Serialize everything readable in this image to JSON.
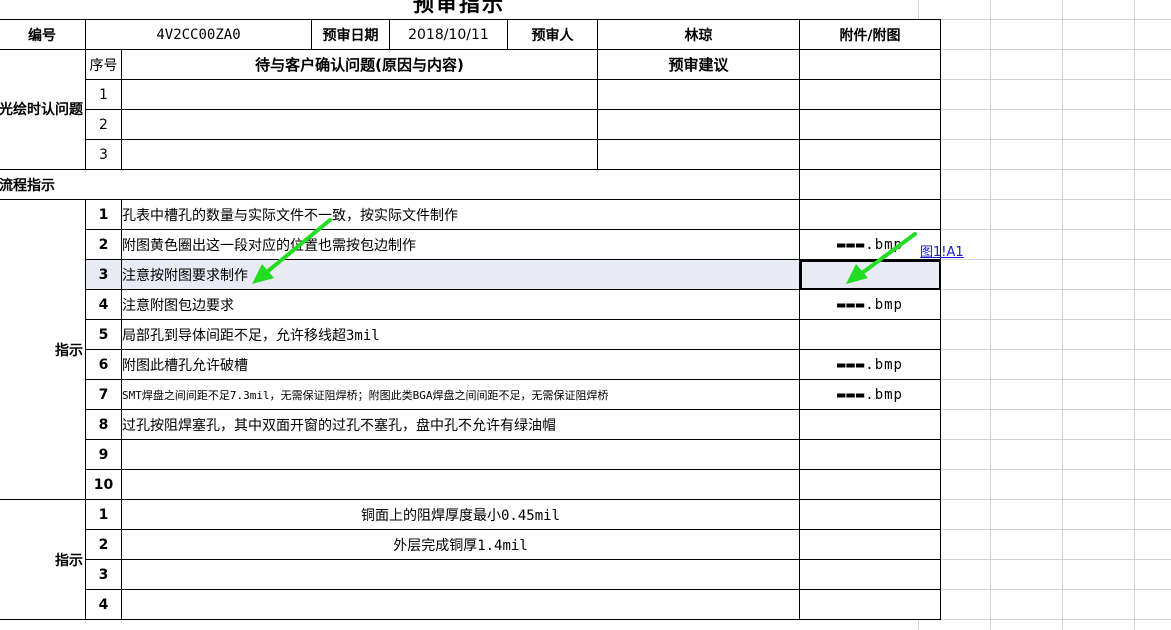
{
  "sheet": {
    "title": "预审指示",
    "header": {
      "label_no": "编号",
      "code": "4V2CC00ZA0",
      "label_date": "预审日期",
      "date": "2018/10/11",
      "label_reviewer": "预审人",
      "reviewer": "林琼",
      "label_attach": "附件/附图"
    },
    "confirm": {
      "side_label": "光绘时认问题",
      "col_seq": "序号",
      "col_issue": "待与客户确认问题(原因与内容)",
      "col_suggest": "预审建议",
      "rows": [
        "1",
        "2",
        "3"
      ]
    },
    "flow_label": "流程指示",
    "section_a": {
      "side_label": "指示",
      "rows": [
        {
          "no": "1",
          "text": "孔表中槽孔的数量与实际文件不一致，按实际文件制作",
          "attach": ""
        },
        {
          "no": "2",
          "text": "附图黄色圈出这一段对应的位置也需按包边制作",
          "attach": "▬▬▬.bmp"
        },
        {
          "no": "3",
          "text": "注意按附图要求制作",
          "attach": ""
        },
        {
          "no": "4",
          "text": "注意附图包边要求",
          "attach": "▬▬▬.bmp"
        },
        {
          "no": "5",
          "text": "局部孔到导体间距不足，允许移线超3mil",
          "attach": ""
        },
        {
          "no": "6",
          "text": "附图此槽孔允许破槽",
          "attach": "▬▬▬.bmp"
        },
        {
          "no": "7",
          "text": "SMT焊盘之间间距不足7.3mil，无需保证阻焊桥；附图此类BGA焊盘之间间距不足，无需保证阻焊桥",
          "attach": "▬▬▬.bmp"
        },
        {
          "no": "8",
          "text": "过孔按阻焊塞孔，其中双面开窗的过孔不塞孔，盘中孔不允许有绿油帽",
          "attach": ""
        },
        {
          "no": "9",
          "text": "",
          "attach": ""
        },
        {
          "no": "10",
          "text": "",
          "attach": ""
        }
      ]
    },
    "section_b": {
      "side_label": "指示",
      "rows": [
        {
          "no": "1",
          "text": "铜面上的阻焊厚度最小0.45mil"
        },
        {
          "no": "2",
          "text": "外层完成铜厚1.4mil"
        },
        {
          "no": "3",
          "text": ""
        },
        {
          "no": "4",
          "text": ""
        }
      ]
    },
    "hyperlink": "图1!A1",
    "arrow_color": "#22dd22"
  }
}
